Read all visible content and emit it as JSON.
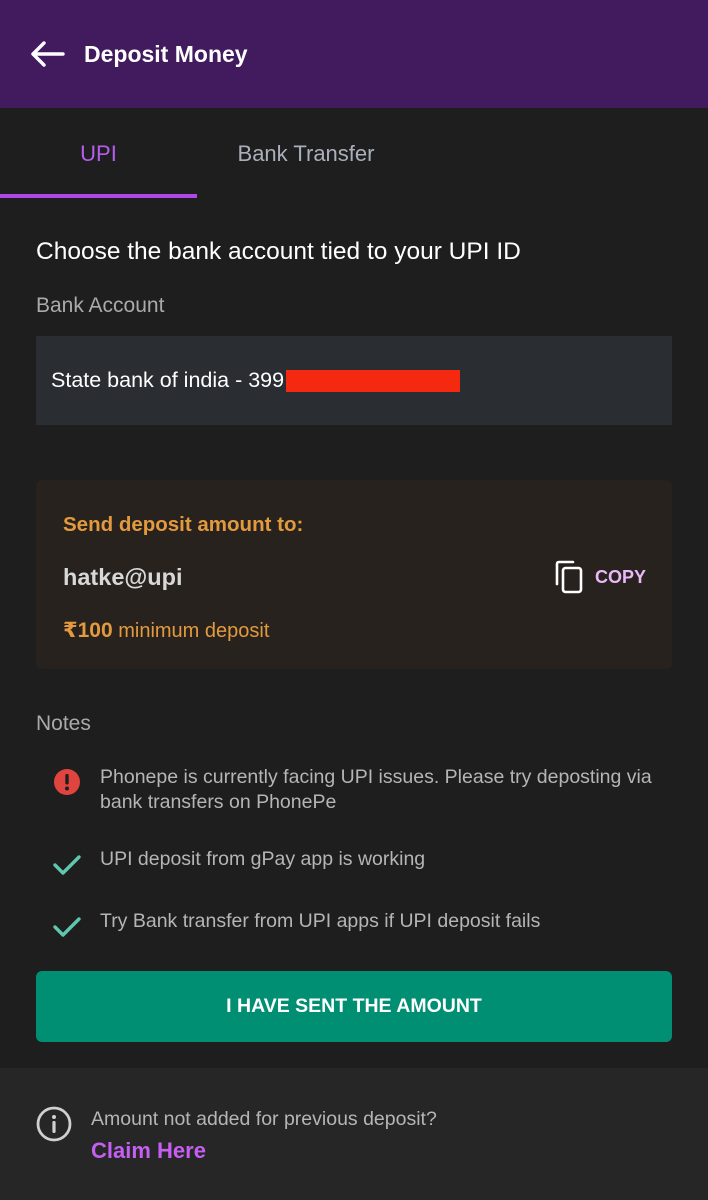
{
  "header": {
    "title": "Deposit Money",
    "back_icon": "arrow-left-icon"
  },
  "tabs": [
    {
      "label": "UPI",
      "active": true
    },
    {
      "label": "Bank Transfer",
      "active": false
    }
  ],
  "upi_section": {
    "title": "Choose the bank account tied to your UPI ID",
    "bank_label": "Bank Account",
    "bank_value": "State bank of india - 399"
  },
  "deposit_card": {
    "send_label": "Send deposit amount to:",
    "upi_id": "hatke@upi",
    "copy_label": "COPY",
    "copy_icon": "copy-icon",
    "min_amount": "₹100",
    "min_text": "minimum deposit"
  },
  "notes": {
    "label": "Notes",
    "items": [
      {
        "icon": "error-icon",
        "text": "Phonepe is currently facing UPI issues. Please try deposting via bank transfers on PhonePe"
      },
      {
        "icon": "check-icon",
        "text": "UPI deposit from gPay app is working"
      },
      {
        "icon": "check-icon",
        "text": "Try Bank transfer from UPI apps if UPI deposit fails"
      }
    ]
  },
  "action": {
    "label": "I HAVE SENT THE AMOUNT"
  },
  "footer": {
    "text": "Amount not added for previous deposit?",
    "link": "Claim Here",
    "icon": "info-icon"
  },
  "colors": {
    "header_bg": "#421b5e",
    "accent_purple": "#b046e6",
    "orange": "#e39a3f",
    "button_green": "#008f73",
    "redaction": "#f5290f"
  }
}
